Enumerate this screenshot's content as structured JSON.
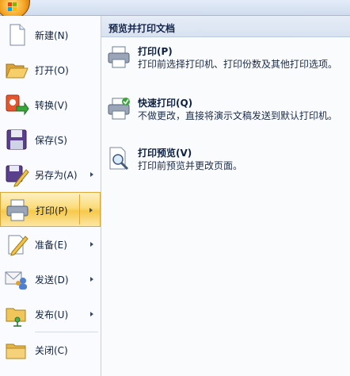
{
  "menu": {
    "items": [
      {
        "id": "new",
        "label": "新建(N)",
        "has_submenu": false
      },
      {
        "id": "open",
        "label": "打开(O)",
        "has_submenu": false
      },
      {
        "id": "convert",
        "label": "转换(V)",
        "has_submenu": false
      },
      {
        "id": "save",
        "label": "保存(S)",
        "has_submenu": false
      },
      {
        "id": "save_as",
        "label": "另存为(A)",
        "has_submenu": true
      },
      {
        "id": "print",
        "label": "打印(P)",
        "has_submenu": true,
        "active": true
      },
      {
        "id": "prepare",
        "label": "准备(E)",
        "has_submenu": true
      },
      {
        "id": "send",
        "label": "发送(D)",
        "has_submenu": true
      },
      {
        "id": "publish",
        "label": "发布(U)",
        "has_submenu": true
      },
      {
        "id": "close",
        "label": "关闭(C)",
        "has_submenu": false
      }
    ]
  },
  "panel": {
    "title": "预览并打印文档",
    "options": [
      {
        "id": "print",
        "title": "打印(P)",
        "desc": "打印前选择打印机、打印份数及其他打印选项。",
        "icon": "printer-icon"
      },
      {
        "id": "quick_print",
        "title": "快速打印(Q)",
        "desc": "不做更改，直接将演示文稿发送到默认打印机。",
        "icon": "quick-print-icon"
      },
      {
        "id": "print_preview",
        "title": "打印预览(V)",
        "desc": "打印前预览并更改页面。",
        "icon": "print-preview-icon"
      }
    ]
  },
  "colors": {
    "active_highlight": "#fbdc7a",
    "menu_bg": "#f9fbfe",
    "panel_bg": "#fafbfd",
    "text": "#0f2142"
  }
}
